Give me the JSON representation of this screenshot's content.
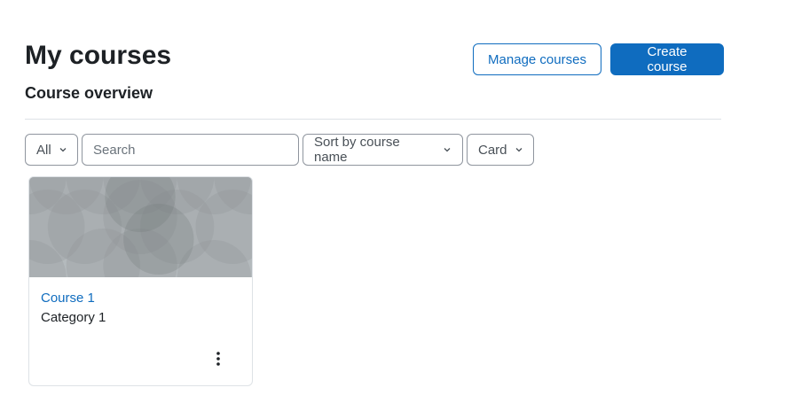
{
  "header": {
    "title": "My courses",
    "manage_label": "Manage courses",
    "create_label": "Create course"
  },
  "overview": {
    "title": "Course overview"
  },
  "filters": {
    "grouping_value": "All",
    "search_placeholder": "Search",
    "sort_value": "Sort by course name",
    "view_value": "Card"
  },
  "courses": [
    {
      "name": "Course 1",
      "category": "Category 1"
    }
  ],
  "colors": {
    "accent": "#0f6cbf",
    "text": "#1d2125",
    "border": "#8f959e",
    "card_image": "#a9b0b3"
  },
  "icons": {
    "dropdown": "chevron-down-icon",
    "card_menu": "vertical-ellipsis-icon"
  }
}
